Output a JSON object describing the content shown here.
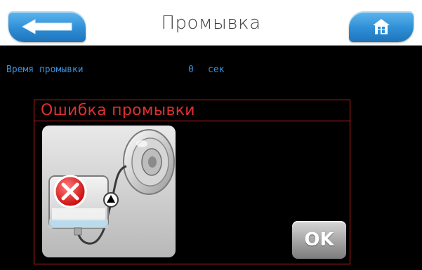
{
  "header": {
    "title": "Промывка",
    "back_icon": "arrow-left-icon",
    "home_icon": "home-icon"
  },
  "status": {
    "label": "Время промывки",
    "value": "0",
    "unit": "сек"
  },
  "dialog": {
    "title": "Ошибка промывки",
    "illustration_icons": [
      "error-icon",
      "fluid-container-icon",
      "valve-disc-icon",
      "flow-direction-icon"
    ],
    "ok_label": "OK"
  },
  "colors": {
    "background": "#000000",
    "header_background": "#ffffff",
    "button_blue": "#2e8fd6",
    "status_text": "#3a8fd6",
    "error_red": "#cc1f1f",
    "ok_gray": "#a8a8a8"
  }
}
